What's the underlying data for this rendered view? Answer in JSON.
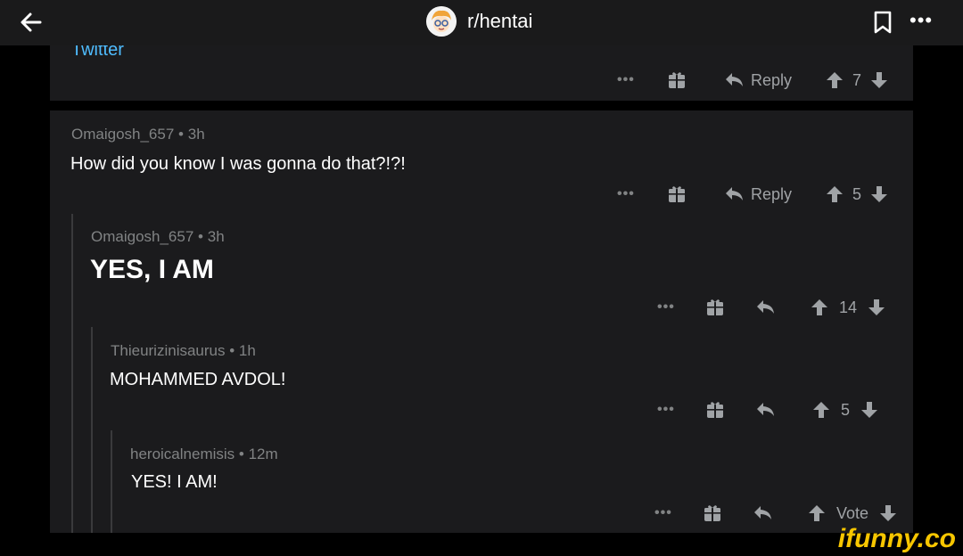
{
  "topbar": {
    "subreddit": "r/hentai"
  },
  "card1": {
    "link_text": "Twitter",
    "actions": {
      "reply_label": "Reply",
      "votes": "7"
    }
  },
  "comments": [
    {
      "author": "Omaigosh_657",
      "time": "3h",
      "text": "How did you know I was gonna do that?!?!",
      "reply_label": "Reply",
      "votes": "5"
    },
    {
      "author": "Omaigosh_657",
      "time": "3h",
      "text": "YES, I AM",
      "votes": "14"
    },
    {
      "author": "Thieurizinisaurus",
      "time": "1h",
      "text": "MOHAMMED AVDOL!",
      "votes": "5"
    },
    {
      "author": "heroicalnemisis",
      "time": "12m",
      "text": "YES! I AM!",
      "votes": "Vote"
    }
  ],
  "watermark": "ifunny.co",
  "colors": {
    "background": "#000000",
    "card": "#1b1b1d",
    "link": "#4fbcff",
    "meta": "#818384",
    "watermark": "#f7c600"
  },
  "icons": [
    "back-arrow-icon",
    "subreddit-avatar",
    "bookmark-icon",
    "more-icon",
    "gift-icon",
    "reply-icon",
    "upvote-icon",
    "downvote-icon"
  ]
}
